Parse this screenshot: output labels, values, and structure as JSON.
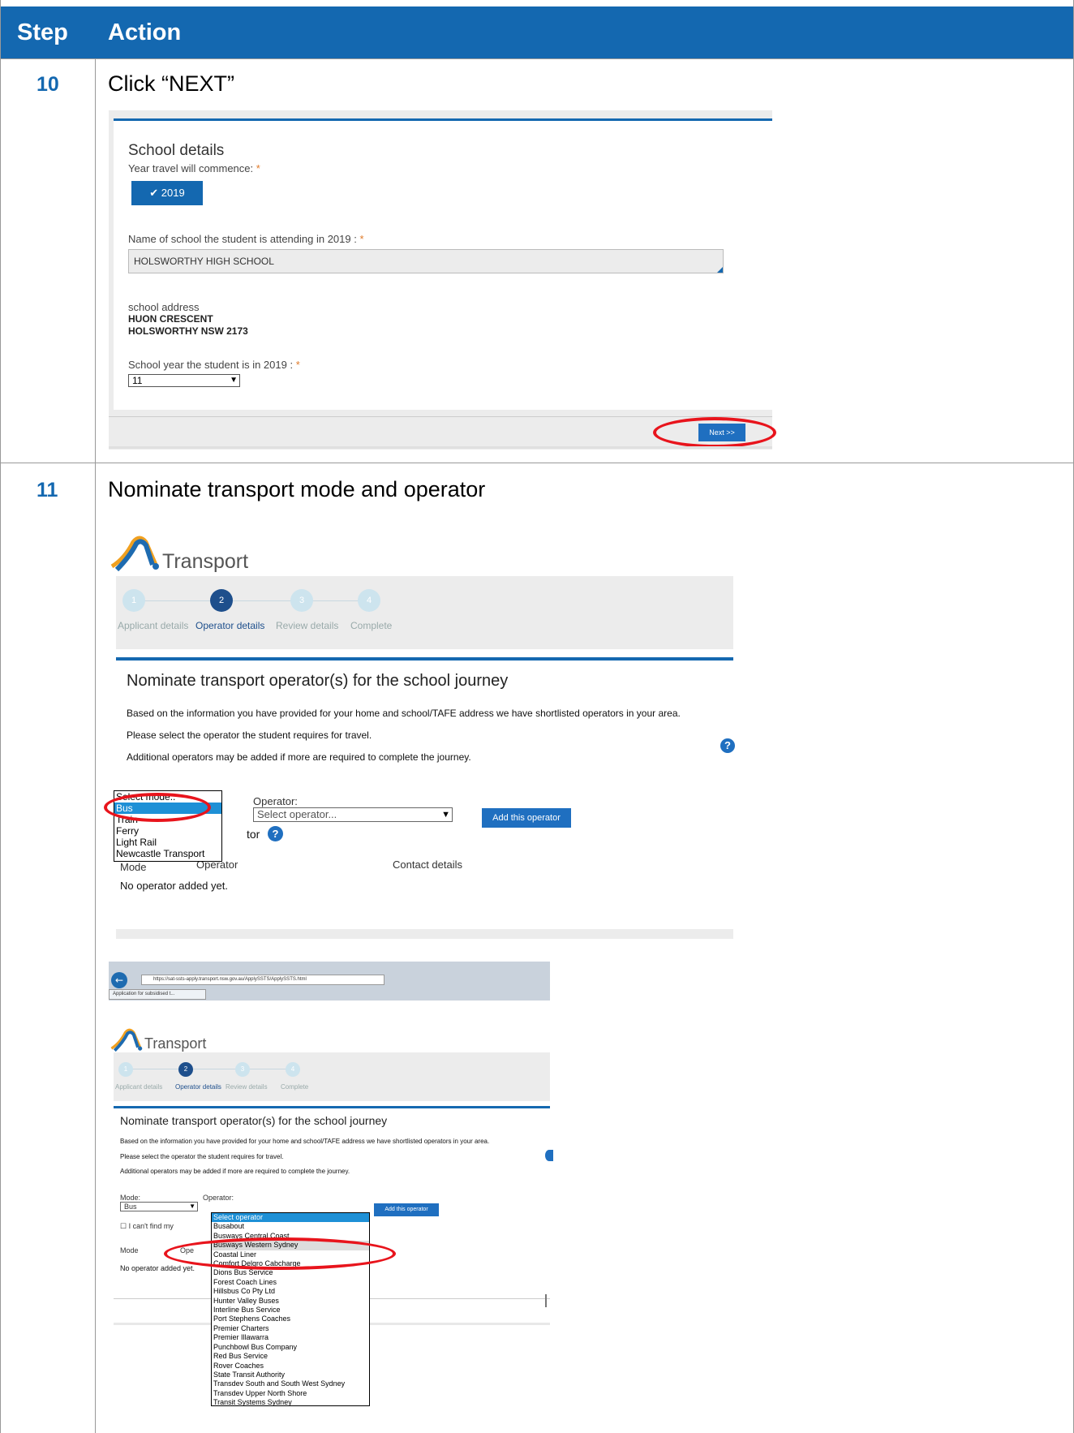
{
  "table": {
    "header_step": "Step",
    "header_action": "Action"
  },
  "step10": {
    "number": "10",
    "action": "Click “NEXT”",
    "shot": {
      "title": "School details",
      "year_label": "Year travel will commence:",
      "year_button": "2019",
      "school_label": "Name of school the student is attending in 2019 :",
      "school_value": "HOLSWORTHY HIGH SCHOOL",
      "address_label": "school address",
      "address_line1": "HUON CRESCENT",
      "address_line2": "HOLSWORTHY NSW 2173",
      "school_year_label": "School year the student is in 2019 :",
      "school_year_value": "11",
      "next_button": "Next >>"
    }
  },
  "step11": {
    "number": "11",
    "action": "Nominate transport mode and operator",
    "shot_a": {
      "logo": "Transport",
      "steps": [
        {
          "num": "1",
          "label": "Applicant details"
        },
        {
          "num": "2",
          "label": "Operator details"
        },
        {
          "num": "3",
          "label": "Review details"
        },
        {
          "num": "4",
          "label": "Complete"
        }
      ],
      "heading": "Nominate transport operator(s) for the school journey",
      "para1": "Based on the information you have provided for your home and school/TAFE address we have shortlisted operators in your area.",
      "para2": "Please select the operator the student requires for travel.",
      "para3": "Additional operators may be added if more are required to complete the journey.",
      "mode_options": [
        "Select mode..",
        "Bus",
        "Train",
        "Ferry",
        "Light Rail",
        "Newcastle Transport"
      ],
      "mode_selected": "Bus",
      "operator_label": "Operator:",
      "operator_placeholder": "Select operator...",
      "add_button": "Add this operator",
      "partial_label": "tor",
      "col_mode": "Mode",
      "col_operator": "Operator",
      "col_contact": "Contact details",
      "empty_text": "No operator added yet."
    },
    "shot_b": {
      "url": "https://sat-ssts-apply.transport.nsw.gov.au/ApplySSTS/ApplySSTS.html",
      "tab_title": "Application for subsidised t...",
      "logo": "Transport",
      "steps": [
        {
          "num": "1",
          "label": "Applicant details"
        },
        {
          "num": "2",
          "label": "Operator details"
        },
        {
          "num": "3",
          "label": "Review details"
        },
        {
          "num": "4",
          "label": "Complete"
        }
      ],
      "heading": "Nominate transport operator(s) for the school journey",
      "para1": "Based on the information you have provided for your home and school/TAFE address we have shortlisted operators in your area.",
      "para2": "Please select the operator the student requires for travel.",
      "para3": "Additional operators may be added if more are required to complete the journey.",
      "mode_label": "Mode:",
      "mode_value": "Bus",
      "operator_label": "Operator:",
      "add_button": "Add this operator",
      "cant_find": "I can't find my",
      "col_mode": "Mode",
      "col_operator": "Ope",
      "empty_text": "No operator added yet.",
      "operators": [
        "Select operator",
        "Busabout",
        "Busways Central Coast",
        "Busways Western Sydney",
        "Coastal Liner",
        "Comfort Delgro Cabcharge",
        "Dions Bus Service",
        "Forest Coach Lines",
        "Hillsbus Co Pty Ltd",
        "Hunter Valley Buses",
        "Interline Bus Service",
        "Port Stephens Coaches",
        "Premier Charters",
        "Premier Illawarra",
        "Punchbowl Bus Company",
        "Red Bus Service",
        "Rover Coaches",
        "State Transit Authority",
        "Transdev South and South West Sydney",
        "Transdev Upper North Shore",
        "Transit Systems Sydney"
      ],
      "operator_selected": "Select operator",
      "operator_highlight": "Busways Western Sydney"
    }
  },
  "colors": {
    "header_blue": "#1468b0",
    "highlight_red": "#e8141c",
    "button_blue": "#1f6fc0"
  }
}
